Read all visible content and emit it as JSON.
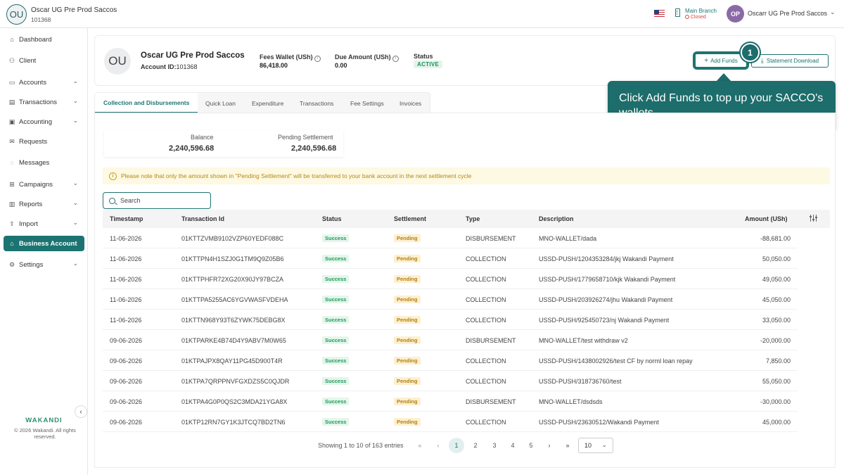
{
  "topbar": {
    "org_initials": "OU",
    "org_name": "Oscar UG Pre Prod Saccos",
    "org_id": "101368",
    "branch_name": "Main Branch",
    "branch_status": "Closed",
    "user_initials": "OP",
    "user_name": "Oscarr UG Pre Prod Saccos"
  },
  "sidebar": {
    "items": [
      {
        "label": "Dashboard",
        "icon": "home-icon"
      },
      {
        "label": "Client",
        "icon": "users-icon"
      },
      {
        "label": "Accounts",
        "icon": "wallet-icon"
      },
      {
        "label": "Transactions",
        "icon": "money-icon"
      },
      {
        "label": "Accounting",
        "icon": "ledger-icon"
      },
      {
        "label": "Requests",
        "icon": "mail-icon"
      },
      {
        "label": "Messages",
        "icon": "chat-icon"
      },
      {
        "label": "Campaigns",
        "icon": "grid-icon"
      },
      {
        "label": "Reports",
        "icon": "chart-icon"
      },
      {
        "label": "Import",
        "icon": "upload-icon"
      },
      {
        "label": "Business Account",
        "icon": "bank-icon"
      },
      {
        "label": "Settings",
        "icon": "gear-icon"
      }
    ],
    "active_item": "Business Account",
    "brand": "WAKANDI",
    "copyright": "© 2026 Wakandi. All rights reserved."
  },
  "org": {
    "initials": "OU",
    "name": "Oscar UG Pre Prod Saccos",
    "account_label": "Account ID:",
    "account_id": "101368",
    "fees_wallet_label": "Fees Wallet (USh)",
    "fees_wallet_value": "86,418.00",
    "due_amount_label": "Due Amount (USh)",
    "due_amount_value": "0.00",
    "status_label": "Status",
    "status_value": "ACTIVE",
    "add_funds_label": "Add Funds",
    "statement_label": "Statement Download"
  },
  "tour": {
    "step": "1",
    "text": "Click Add Funds to top up your SACCO's wallets."
  },
  "tabs": [
    "Collection and Disbursements",
    "Quick Loan",
    "Expenditure",
    "Transactions",
    "Fee Settings",
    "Invoices"
  ],
  "balances": {
    "balance_label": "Balance",
    "balance_value": "2,240,596.68",
    "pending_label": "Pending Settlement",
    "pending_value": "2,240,596.68"
  },
  "notice": "Please note that only the amount shown in \"Pending Settlement\" will be transferred to your bank account in the next settlement cycle",
  "search": {
    "placeholder": "Search"
  },
  "table": {
    "headers": [
      "Timestamp",
      "Transaction Id",
      "Status",
      "Settlement",
      "Type",
      "Description",
      "Amount (USh)"
    ],
    "rows": [
      {
        "timestamp": "11-06-2026",
        "id": "01KTTZVMB9102VZP60YEDF088C",
        "status": "Success",
        "settlement": "Pending",
        "type": "DISBURSEMENT",
        "description": "MNO-WALLET/dada",
        "amount": "-88,681.00"
      },
      {
        "timestamp": "11-06-2026",
        "id": "01KTTPN4H1SZJ0G1TM9Q9Z05B6",
        "status": "Success",
        "settlement": "Pending",
        "type": "COLLECTION",
        "description": "USSD-PUSH/1204353284/jkj Wakandi Payment",
        "amount": "50,050.00"
      },
      {
        "timestamp": "11-06-2026",
        "id": "01KTTPHFR72XG20X90JY97BCZA",
        "status": "Success",
        "settlement": "Pending",
        "type": "COLLECTION",
        "description": "USSD-PUSH/1779658710/kjk Wakandi Payment",
        "amount": "49,050.00"
      },
      {
        "timestamp": "11-06-2026",
        "id": "01KTTPA5255AC6YGVWASFVDEHA",
        "status": "Success",
        "settlement": "Pending",
        "type": "COLLECTION",
        "description": "USSD-PUSH/203926274/jhu Wakandi Payment",
        "amount": "45,050.00"
      },
      {
        "timestamp": "11-06-2026",
        "id": "01KTTN968Y93T6ZYWK75DEBG8X",
        "status": "Success",
        "settlement": "Pending",
        "type": "COLLECTION",
        "description": "USSD-PUSH/925450723/nj Wakandi Payment",
        "amount": "33,050.00"
      },
      {
        "timestamp": "09-06-2026",
        "id": "01KTPARKE4B74D4Y9ABV7M0W65",
        "status": "Success",
        "settlement": "Pending",
        "type": "DISBURSEMENT",
        "description": "MNO-WALLET/test withdraw v2",
        "amount": "-20,000.00"
      },
      {
        "timestamp": "09-06-2026",
        "id": "01KTPAJPX8QAY11PG45D900T4R",
        "status": "Success",
        "settlement": "Pending",
        "type": "COLLECTION",
        "description": "USSD-PUSH/1438002926/test CF by norml loan repay",
        "amount": "7,850.00"
      },
      {
        "timestamp": "09-06-2026",
        "id": "01KTPA7QRPPNVFGXDZS5C0QJDR",
        "status": "Success",
        "settlement": "Pending",
        "type": "COLLECTION",
        "description": "USSD-PUSH/318736760/test",
        "amount": "55,050.00"
      },
      {
        "timestamp": "09-06-2026",
        "id": "01KTPA4G0P0QS2C3MDA21YGA8X",
        "status": "Success",
        "settlement": "Pending",
        "type": "DISBURSEMENT",
        "description": "MNO-WALLET/dsdsds",
        "amount": "-30,000.00"
      },
      {
        "timestamp": "09-06-2026",
        "id": "01KTP12RN7GY1K3JTCQ7BD2TN6",
        "status": "Success",
        "settlement": "Pending",
        "type": "COLLECTION",
        "description": "USSD-PUSH/23630512/Wakandi Payment",
        "amount": "45,000.00"
      }
    ]
  },
  "pagination": {
    "info": "Showing 1 to 10 of 163 entries",
    "pages": [
      "1",
      "2",
      "3",
      "4",
      "5"
    ],
    "current": "1",
    "page_size": "10"
  },
  "colors": {
    "accent": "#1c7472",
    "success": "#1e9a5b",
    "pending": "#b38018"
  }
}
